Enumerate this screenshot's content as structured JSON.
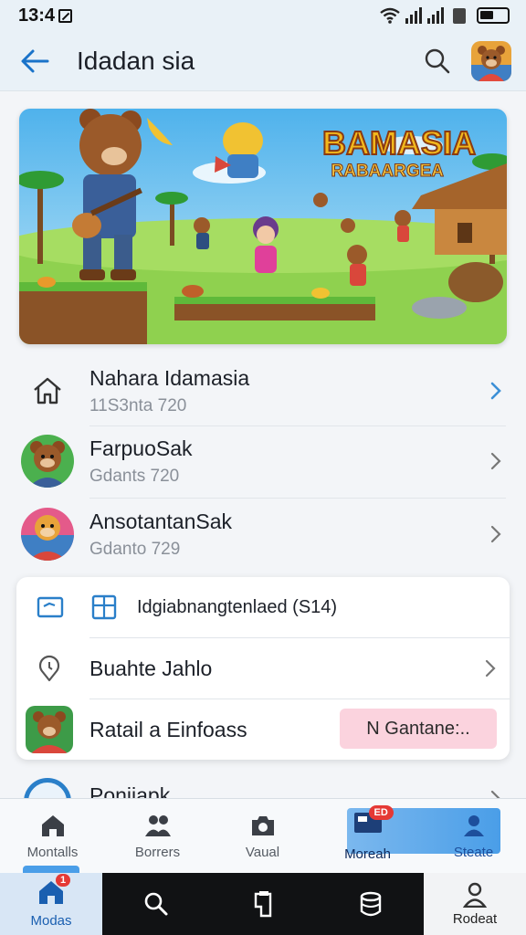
{
  "status_bar": {
    "time": "13:4"
  },
  "app_bar": {
    "title": "Idadan sia"
  },
  "banner": {
    "title": "BAMASIA",
    "subtitle": "RABAARGEA"
  },
  "list": [
    {
      "title": "Nahara Idamasia",
      "subtitle": "11S3nta 720"
    },
    {
      "title": "FarpuoSak",
      "subtitle": "Gdants 720"
    },
    {
      "title": "AnsotantanSak",
      "subtitle": "Gdanto 729"
    }
  ],
  "card": {
    "row1_label": "Idgiabnangtenlaed (S14)",
    "row2_label": "Buahte Jahlo",
    "row3_label": "Ratail a Einfoass",
    "row3_button": "N Gantane:.."
  },
  "partial_row": {
    "title": "Ponjiapk"
  },
  "tabs": [
    {
      "label": "Montalls",
      "icon": "home-icon"
    },
    {
      "label": "Borrers",
      "icon": "people-icon"
    },
    {
      "label": "Vaual",
      "icon": "camera-icon"
    },
    {
      "label": "Moreah",
      "icon": "folder-icon",
      "badge": "ED"
    },
    {
      "label": "Steate",
      "icon": "person-icon"
    }
  ],
  "bottom_nav": [
    {
      "label": "Modas",
      "icon": "home-icon",
      "badge": "1"
    },
    {
      "label": "",
      "icon": "search-icon"
    },
    {
      "label": "",
      "icon": "clipboard-icon"
    },
    {
      "label": "",
      "icon": "database-icon"
    },
    {
      "label": "Rodeat",
      "icon": "profile-icon"
    }
  ],
  "colors": {
    "accent": "#1a73c9",
    "active_tab": "#4a9ee8",
    "pill": "#fbd3de",
    "badge": "#e53935"
  }
}
